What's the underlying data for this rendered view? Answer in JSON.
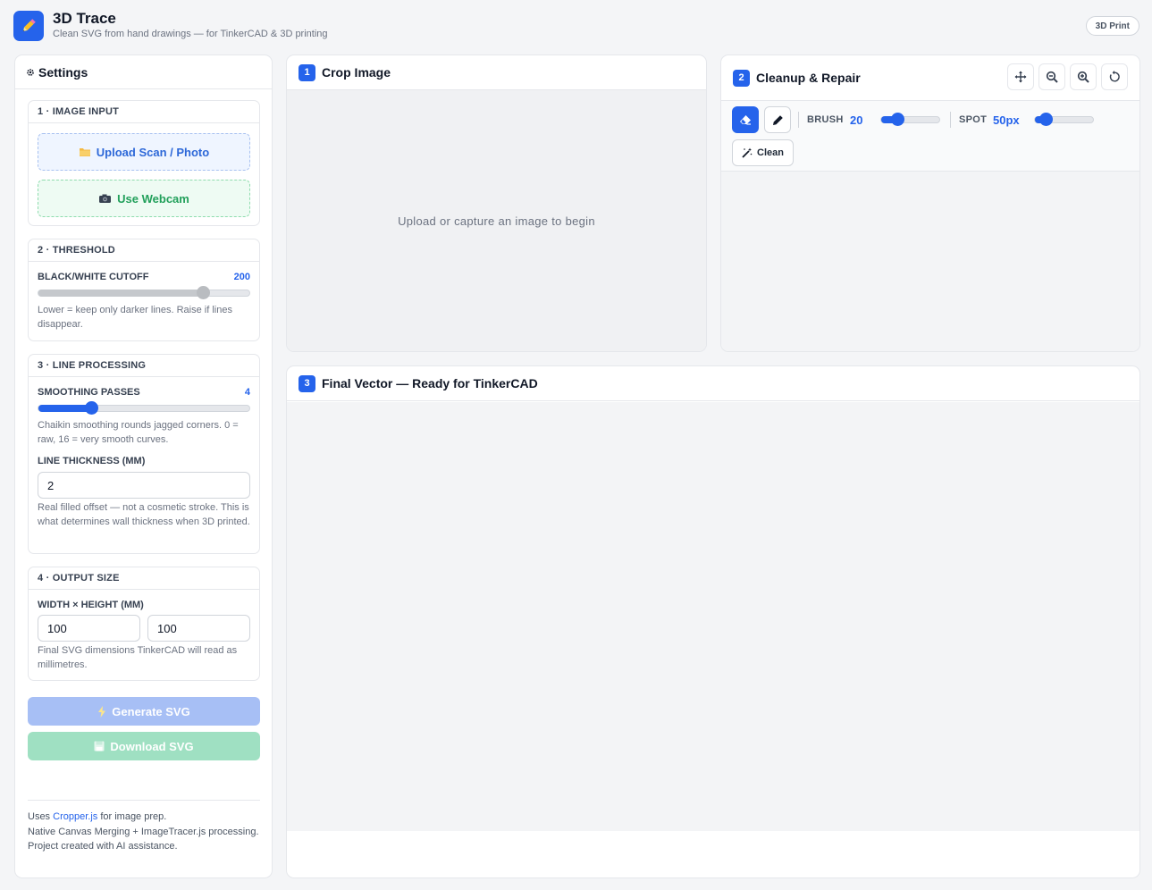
{
  "header": {
    "logo_icon": "pencil-icon",
    "title": "3D Trace",
    "subtitle": "Clean SVG from hand drawings — for TinkerCAD & 3D printing",
    "badge": "3D Print"
  },
  "sidebar": {
    "title_icon": "gear-icon",
    "title": "Settings",
    "image_input": {
      "title": "1 · IMAGE INPUT",
      "upload_icon": "folder-icon",
      "upload_label": "Upload Scan / Photo",
      "webcam_icon": "camera-icon",
      "webcam_label": "Use Webcam"
    },
    "threshold": {
      "title": "2 · THRESHOLD",
      "label": "BLACK/WHITE CUTOFF",
      "value": "200",
      "level": 0.78,
      "hint": "Lower = keep only darker lines. Raise if lines disappear."
    },
    "line_processing": {
      "title": "3 · LINE PROCESSING",
      "smoothing_label": "SMOOTHING PASSES",
      "smoothing_value": "4",
      "smoothing_level": 0.25,
      "smoothing_hint": "Chaikin smoothing rounds jagged corners. 0 = raw, 16 = very smooth curves.",
      "thickness_label": "LINE THICKNESS (MM)",
      "thickness_value": "2",
      "thickness_hint": "Real filled offset — not a cosmetic stroke. This is what determines wall thickness when 3D printed."
    },
    "output_size": {
      "title": "4 · OUTPUT SIZE",
      "label": "WIDTH × HEIGHT (MM)",
      "width": "100",
      "height": "100",
      "hint": "Final SVG dimensions TinkerCAD will read as millimetres."
    },
    "generate_icon": "lightning-icon",
    "generate_label": "Generate SVG",
    "download_icon": "floppy-disk-icon",
    "download_label": "Download SVG",
    "footer": {
      "line1_prefix": "Uses ",
      "line1_link": "Cropper.js",
      "line1_suffix": " for image prep.",
      "line2": "Native Canvas Merging + ImageTracer.js processing.",
      "line3": "Project created with AI assistance."
    }
  },
  "crop": {
    "step": "1",
    "title": "Crop Image",
    "placeholder": "Upload or capture an image to begin"
  },
  "cleanup": {
    "step": "2",
    "title": "Cleanup & Repair",
    "toolbar_icons": [
      "move-icon",
      "zoom-out-icon",
      "zoom-in-icon",
      "reset-icon"
    ],
    "eraser_icon": "eraser-icon",
    "pen_icon": "pen-icon",
    "brush_label": "BRUSH",
    "brush_value": "20",
    "brush_level": 0.28,
    "spot_label": "SPOT",
    "spot_value": "50px",
    "spot_level": 0.18,
    "clean_icon": "magic-wand-icon",
    "clean_label": "Clean"
  },
  "vector": {
    "step": "3",
    "title": "Final Vector — Ready for TinkerCAD"
  },
  "colors": {
    "accent": "#2563eb",
    "upload_bg": "#eff5ff",
    "webcam_bg": "#eefbf3",
    "generate_disabled": "#a7bff5",
    "download_disabled": "#9fe0c2",
    "threshold_track": "#c5c8cc"
  }
}
